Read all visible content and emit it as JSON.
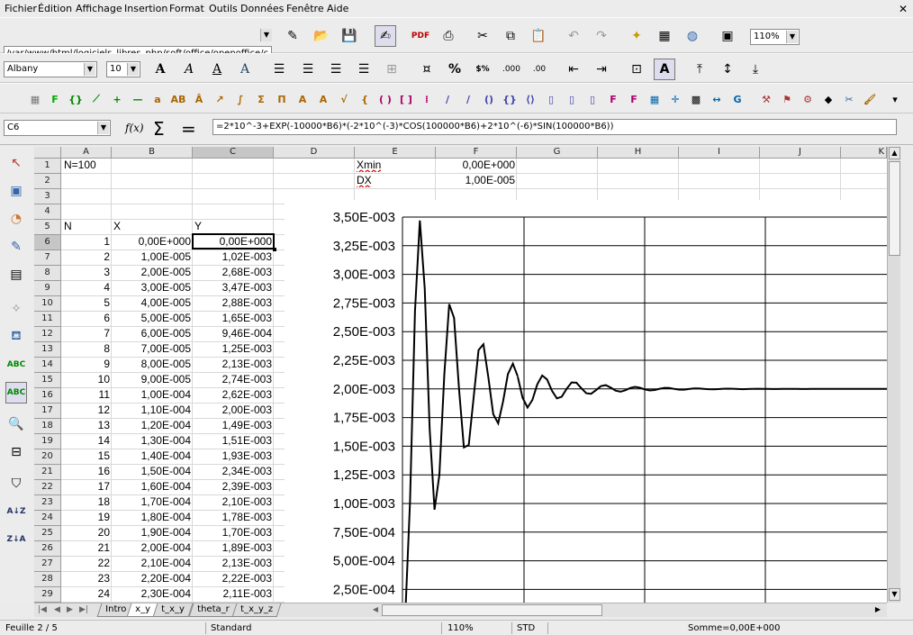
{
  "menu": [
    "Fichier",
    "Édition",
    "Affichage",
    "Insertion",
    "Format",
    "Outils",
    "Données",
    "Fenêtre",
    "Aide"
  ],
  "close_glyph": "✕",
  "url": "/var/www/html/logiciels_libres_php/soft/office/openoffice/c",
  "zoom_select": "110%",
  "font_name": "Albany",
  "font_size": "10",
  "name_box": "C6",
  "formula_fx": "f(x)",
  "formula_sigma": "Σ",
  "formula_equals": "=",
  "formula": "=2*10^-3+EXP(-10000*B6)*(-2*10^(-3)*COS(100000*B6)+2*10^(-6)*SIN(100000*B6))",
  "columns": [
    "A",
    "B",
    "C",
    "D",
    "E",
    "F",
    "G",
    "H",
    "I",
    "J",
    "K"
  ],
  "rows": [
    "1",
    "2",
    "3",
    "4",
    "5",
    "6",
    "7",
    "8",
    "9",
    "10",
    "11",
    "12",
    "13",
    "14",
    "15",
    "16",
    "17",
    "18",
    "19",
    "20",
    "21",
    "22",
    "23",
    "24",
    "25",
    "26",
    "27",
    "28",
    "29"
  ],
  "cells": {
    "a1": "N=100",
    "e1": "Xmin",
    "f1": "0,00E+000",
    "e2": "DX",
    "f2": "1,00E-005",
    "a5": "N",
    "b5": "X",
    "c5": "Y"
  },
  "table": [
    [
      "1",
      "0,00E+000",
      "0,00E+000"
    ],
    [
      "2",
      "1,00E-005",
      "1,02E-003"
    ],
    [
      "3",
      "2,00E-005",
      "2,68E-003"
    ],
    [
      "4",
      "3,00E-005",
      "3,47E-003"
    ],
    [
      "5",
      "4,00E-005",
      "2,88E-003"
    ],
    [
      "6",
      "5,00E-005",
      "1,65E-003"
    ],
    [
      "7",
      "6,00E-005",
      "9,46E-004"
    ],
    [
      "8",
      "7,00E-005",
      "1,25E-003"
    ],
    [
      "9",
      "8,00E-005",
      "2,13E-003"
    ],
    [
      "10",
      "9,00E-005",
      "2,74E-003"
    ],
    [
      "11",
      "1,00E-004",
      "2,62E-003"
    ],
    [
      "12",
      "1,10E-004",
      "2,00E-003"
    ],
    [
      "13",
      "1,20E-004",
      "1,49E-003"
    ],
    [
      "14",
      "1,30E-004",
      "1,51E-003"
    ],
    [
      "15",
      "1,40E-004",
      "1,93E-003"
    ],
    [
      "16",
      "1,50E-004",
      "2,34E-003"
    ],
    [
      "17",
      "1,60E-004",
      "2,39E-003"
    ],
    [
      "18",
      "1,70E-004",
      "2,10E-003"
    ],
    [
      "19",
      "1,80E-004",
      "1,78E-003"
    ],
    [
      "20",
      "1,90E-004",
      "1,70E-003"
    ],
    [
      "21",
      "2,00E-004",
      "1,89E-003"
    ],
    [
      "22",
      "2,10E-004",
      "2,13E-003"
    ],
    [
      "23",
      "2,20E-004",
      "2,22E-003"
    ],
    [
      "24",
      "2,30E-004",
      "2,11E-003"
    ]
  ],
  "sheet_tabs": [
    "Intro",
    "x_y",
    "t_x_y",
    "theta_r",
    "t_x_y_z"
  ],
  "active_tab": "x_y",
  "status": {
    "sheet": "Feuille 2 / 5",
    "style": "Standard",
    "zoom": "110%",
    "mode": "STD",
    "sum": "Somme=0,00E+000"
  },
  "chart_data": {
    "type": "line",
    "title": "",
    "xlabel": "",
    "ylabel": "",
    "y_ticks": [
      "3,50E-003",
      "3,25E-003",
      "3,00E-003",
      "2,75E-003",
      "2,50E-003",
      "2,25E-003",
      "2,00E-003",
      "1,75E-003",
      "1,50E-003",
      "1,25E-003",
      "1,00E-003",
      "7,50E-004",
      "5,00E-004",
      "2,50E-004"
    ],
    "ylim": [
      0.00025,
      0.0035
    ],
    "xlim": [
      0,
      0.00099
    ],
    "grid": true,
    "series": [
      {
        "x": [
          0,
          1e-05,
          2e-05,
          3e-05,
          4e-05,
          5e-05,
          6e-05,
          7e-05,
          8e-05,
          9e-05,
          0.0001,
          0.00011,
          0.00012,
          0.00013,
          0.00014,
          0.00015,
          0.00016,
          0.00017,
          0.00018,
          0.00019,
          0.0002,
          0.00021,
          0.00022,
          0.00023
        ],
        "y": [
          0,
          0.00102,
          0.00268,
          0.00347,
          0.00288,
          0.00165,
          0.000946,
          0.00125,
          0.00213,
          0.00274,
          0.00262,
          0.002,
          0.00149,
          0.00151,
          0.00193,
          0.00234,
          0.00239,
          0.0021,
          0.00178,
          0.0017,
          0.00189,
          0.00213,
          0.00222,
          0.00211
        ]
      }
    ]
  }
}
